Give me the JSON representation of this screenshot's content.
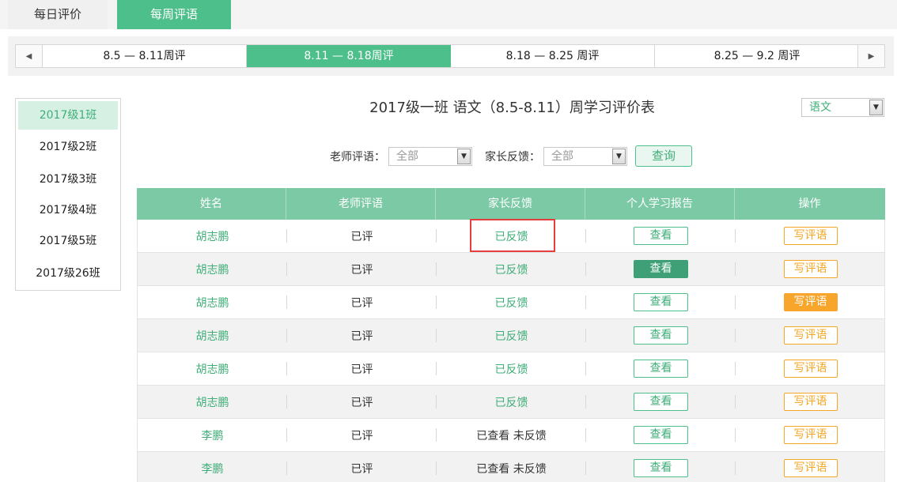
{
  "top_tabs": [
    "每日评价",
    "每周评语"
  ],
  "weeks": {
    "prev_icon": "left-arrow-icon",
    "next_icon": "right-arrow-icon",
    "items": [
      "8.5 — 8.11周评",
      "8.11 — 8.18周评",
      "8.18 — 8.25 周评",
      "8.25 — 9.2 周评"
    ]
  },
  "classes": [
    "2017级1班",
    "2017级2班",
    "2017级3班",
    "2017级4班",
    "2017级5班",
    "2017级26班"
  ],
  "title": "2017级一班 语文（8.5-8.11）周学习评价表",
  "subject_select": {
    "value": "语文"
  },
  "filters": {
    "teacher_label": "老师评语：",
    "teacher_value": "全部",
    "parent_label": "家长反馈：",
    "parent_value": "全部",
    "query_label": "查询"
  },
  "table": {
    "headers": [
      "姓名",
      "老师评语",
      "家长反馈",
      "个人学习报告",
      "操作"
    ],
    "rows": [
      {
        "name": "胡志鹏",
        "teacher": "已评",
        "feedback": "已反馈",
        "view": "查看",
        "write": "写评语"
      },
      {
        "name": "胡志鹏",
        "teacher": "已评",
        "feedback": "已反馈",
        "view": "查看",
        "write": "写评语"
      },
      {
        "name": "胡志鹏",
        "teacher": "已评",
        "feedback": "已反馈",
        "view": "查看",
        "write": "写评语"
      },
      {
        "name": "胡志鹏",
        "teacher": "已评",
        "feedback": "已反馈",
        "view": "查看",
        "write": "写评语"
      },
      {
        "name": "胡志鹏",
        "teacher": "已评",
        "feedback": "已反馈",
        "view": "查看",
        "write": "写评语"
      },
      {
        "name": "胡志鹏",
        "teacher": "已评",
        "feedback": "已反馈",
        "view": "查看",
        "write": "写评语"
      },
      {
        "name": "李鹏",
        "teacher": "已评",
        "feedback": "已查看 未反馈",
        "view": "查看",
        "write": "写评语"
      },
      {
        "name": "李鹏",
        "teacher": "已评",
        "feedback": "已查看 未反馈",
        "view": "查看",
        "write": "写评语"
      }
    ]
  },
  "colors": {
    "accent_green": "#4cbf8a",
    "accent_orange": "#f5a623",
    "highlight_red": "#e53e3e"
  }
}
